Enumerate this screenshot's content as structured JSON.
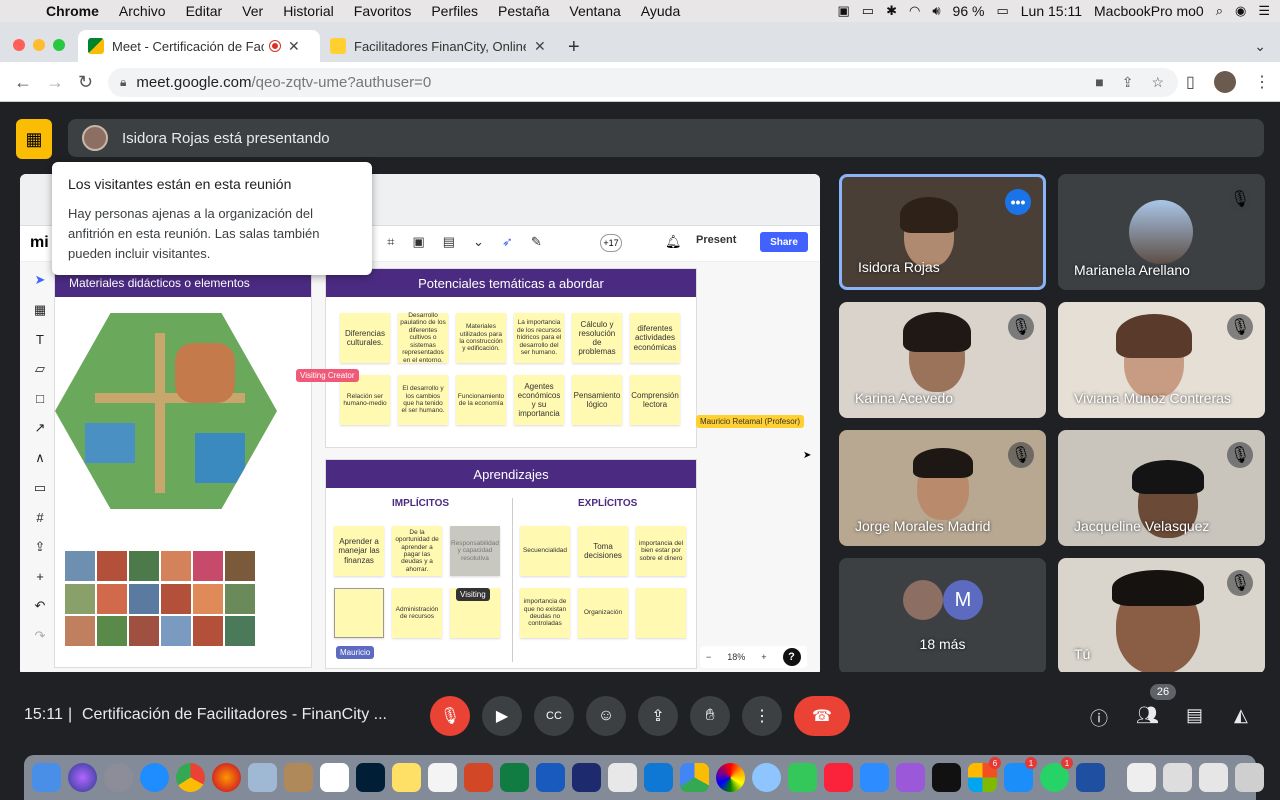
{
  "menubar": {
    "app": "Chrome",
    "items": [
      "Archivo",
      "Editar",
      "Ver",
      "Historial",
      "Favoritos",
      "Perfiles",
      "Pestaña",
      "Ventana",
      "Ayuda"
    ],
    "battery": "96 %",
    "clock": "Lun 15:11",
    "user": "MacbookPro mo0"
  },
  "tabs": [
    {
      "title": "Meet - Certificación de Fac",
      "active": true
    },
    {
      "title": "Facilitadores FinanCity, Online",
      "active": false
    }
  ],
  "omnibox": {
    "host": "meet.google.com",
    "path": "/qeo-zqtv-ume?authuser=0"
  },
  "presenting": {
    "text": "Isidora Rojas está presentando"
  },
  "tooltip": {
    "title": "Los visitantes están en esta reunión",
    "body": "Hay personas ajenas a la organización del anfitrión en esta reunión. Las salas también pueden incluir visitantes."
  },
  "board": {
    "present_label": "Present",
    "share_label": "Share",
    "avatar_count": "+17",
    "frame_a_title": "Materiales didácticos o elementos",
    "frame_b_title": "Potenciales temáticas a abordar",
    "frame_c_title": "Aprendizajes",
    "implicitos": "IMPLÍCITOS",
    "explicitos": "EXPLÍCITOS",
    "notes_b": [
      "Diferencias culturales.",
      "Desarrollo paulatino de los diferentes cultivos o sistemas representados en el entorno.",
      "Materiales utilizados para la construcción y edificación.",
      "La importancia de los recursos hídricos para el desarrollo del ser humano.",
      "Cálculo y resolución de problemas",
      "diferentes actividades económicas",
      "Relación ser humano-medio",
      "El desarrollo y los cambios que ha tenido el ser humano.",
      "Funcionamiento de la economía",
      "Agentes económicos y su importancia",
      "Pensamiento lógico",
      "Comprensión lectora"
    ],
    "notes_implicit": [
      "Aprender a manejar las finanzas",
      "De la oportunidad de aprender a pagar las deudas y a ahorrar.",
      "Responsabilidad y capacidad resolutiva",
      "",
      "Administración de recursos",
      ""
    ],
    "notes_explicit": [
      "Secuencialidad",
      "Toma decisiones",
      "importancia del bien estar por sobre el dinero",
      "importancia de que no existan deudas no controladas",
      "Organización",
      ""
    ],
    "cursor_creator": "Visiting Creator",
    "cursor_mauricio": "Mauricio Retamal (Profesor)",
    "cursor_visiting": "Visiting",
    "cursor_m": "Mauricio",
    "zoom": "18%"
  },
  "participants": [
    {
      "name": "Isidora Rojas"
    },
    {
      "name": "Marianela Arellano"
    },
    {
      "name": "Karina Acevedo"
    },
    {
      "name": "Viviana Munoz Contreras"
    },
    {
      "name": "Jorge Morales Madrid"
    },
    {
      "name": "Jacqueline Velasquez"
    },
    {
      "name": "18 más",
      "initial": "M"
    },
    {
      "name": "Tú"
    }
  ],
  "bottom": {
    "time": "15:11",
    "title": "Certificación de Facilitadores - FinanCity ...",
    "people_count": "26"
  },
  "dock_badges": [
    "6",
    "1",
    "1",
    "1"
  ]
}
